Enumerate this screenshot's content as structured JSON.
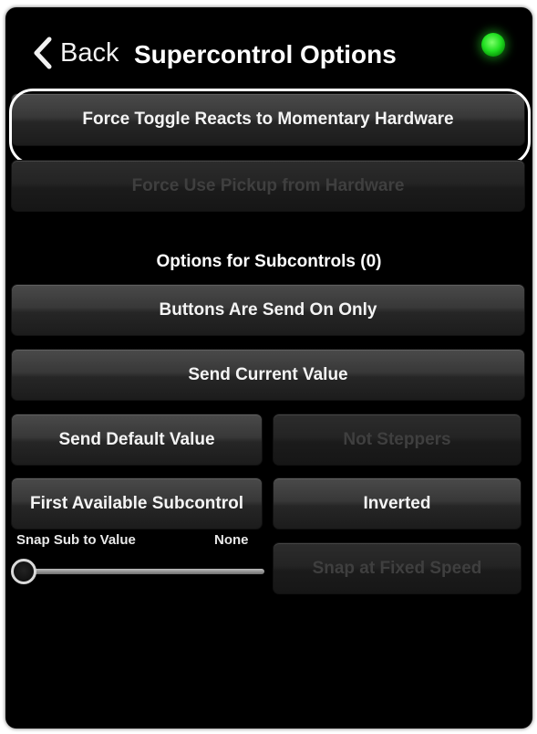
{
  "header": {
    "back_label": "Back",
    "title": "Supercontrol Options",
    "status_led_color": "#21e021"
  },
  "buttons": {
    "force_toggle": "Force Toggle Reacts to Momentary Hardware",
    "force_pickup": "Force Use Pickup from Hardware",
    "buttons_send_on_only": "Buttons Are Send On Only",
    "send_current_value": "Send Current Value",
    "send_default_value": "Send Default Value",
    "not_steppers": "Not Steppers",
    "first_available_subcontrol": "First Available Subcontrol",
    "inverted": "Inverted",
    "snap_fixed_speed": "Snap at Fixed Speed"
  },
  "sections": {
    "subcontrols_heading": "Options for Subcontrols (0)"
  },
  "snap_slider": {
    "label": "Snap Sub to Value",
    "value_text": "None",
    "value": 0
  },
  "disabled": [
    "force_pickup",
    "not_steppers",
    "snap_fixed_speed"
  ],
  "colors": {
    "background": "#000000",
    "button_text": "#f4f4f4",
    "disabled_text": "#3f3f3f",
    "highlight_ring": "#ffffff"
  },
  "icons": {
    "back": "chevron-left-icon",
    "status": "status-led-icon"
  }
}
